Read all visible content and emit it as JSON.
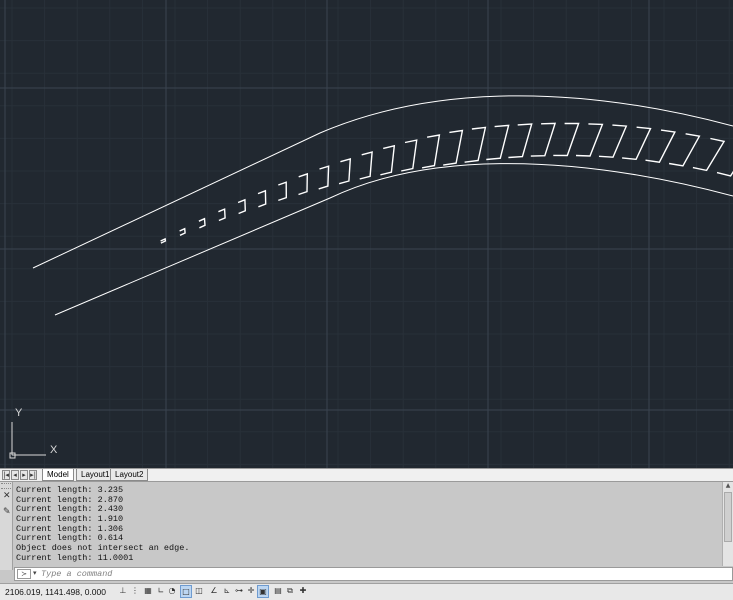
{
  "viewport": {
    "ucs_y_label": "Y",
    "ucs_x_label": "X"
  },
  "layout_tabs": [
    {
      "label": "Model",
      "active": true
    },
    {
      "label": "Layout1",
      "active": false
    },
    {
      "label": "Layout2",
      "active": false
    }
  ],
  "command_window": {
    "history": [
      "Current length: 3.235",
      "Current length: 2.870",
      "Current length: 2.430",
      "Current length: 1.910",
      "Current length: 1.306",
      "Current length: 0.614",
      "Object does not intersect an edge.",
      "Current length: 11.0001"
    ],
    "placeholder": "Type a command"
  },
  "status_bar": {
    "coordinates": "2106.019, 1141.498, 0.000",
    "toggles": [
      {
        "name": "infer-constraints",
        "icon": "infer-icon",
        "glyph": "⊥",
        "on": false
      },
      {
        "name": "snap-mode",
        "icon": "snap-icon",
        "glyph": "⋮",
        "on": false
      },
      {
        "name": "grid-display",
        "icon": "grid-icon",
        "glyph": "▦",
        "on": false
      },
      {
        "name": "ortho-mode",
        "icon": "ortho-icon",
        "glyph": "∟",
        "on": false
      },
      {
        "name": "polar-tracking",
        "icon": "polar-icon",
        "glyph": "◔",
        "on": false
      },
      {
        "name": "object-snap",
        "icon": "osnap-icon",
        "glyph": "□",
        "on": true
      },
      {
        "name": "3d-object-snap",
        "icon": "3dosnap-icon",
        "glyph": "◫",
        "on": false
      },
      {
        "name": "object-snap-tracking",
        "icon": "otrack-icon",
        "glyph": "∠",
        "on": false
      },
      {
        "name": "dynamic-ucs",
        "icon": "ducs-icon",
        "glyph": "⊾",
        "on": false
      },
      {
        "name": "dynamic-input",
        "icon": "dyn-icon",
        "glyph": "⊶",
        "on": false
      },
      {
        "name": "lineweight",
        "icon": "lineweight-icon",
        "glyph": "✛",
        "on": false
      },
      {
        "name": "transparency",
        "icon": "transparency-icon",
        "glyph": "▣",
        "on": true
      },
      {
        "name": "quick-properties",
        "icon": "qp-icon",
        "glyph": "▤",
        "on": false
      },
      {
        "name": "selection-cycling",
        "icon": "sc-icon",
        "glyph": "⧉",
        "on": false
      },
      {
        "name": "annotation-monitor",
        "icon": "am-icon",
        "glyph": "✚",
        "on": false
      }
    ]
  },
  "colors": {
    "canvas_bg": "#212830",
    "grid_major": "#3a4450",
    "grid_minor": "#283039",
    "geometry": "#ffffff"
  }
}
